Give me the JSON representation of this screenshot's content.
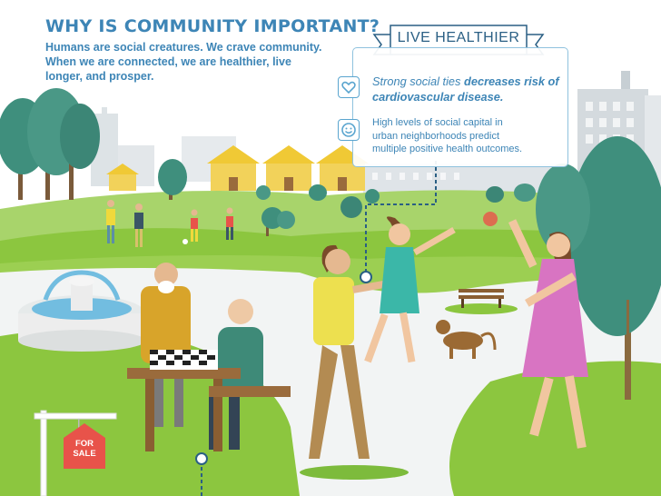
{
  "header": {
    "title": "WHY IS COMMUNITY IMPORTANT?",
    "subtitle_lines": [
      "Humans are social creatures. We crave community.",
      "When we are connected, we are healthier, live",
      "longer, and prosper."
    ]
  },
  "callout": {
    "ribbon": "LIVE HEALTHIER",
    "tip1_prefix": "Strong social ties ",
    "tip1_bold": "decreases risk of cardiovascular disease.",
    "tip1_icon": "heart-icon",
    "tip2_lines": [
      "High levels of social capital in",
      "urban neighborhoods predict",
      "multiple positive health outcomes."
    ],
    "tip2_icon": "smiley-icon"
  },
  "sign": {
    "line1": "FOR",
    "line2": "SALE"
  },
  "colors": {
    "headline": "#3d85b6",
    "ribbon_text": "#2a5f84",
    "grass": "#8cc63f",
    "sale_sign": "#e8534a"
  }
}
